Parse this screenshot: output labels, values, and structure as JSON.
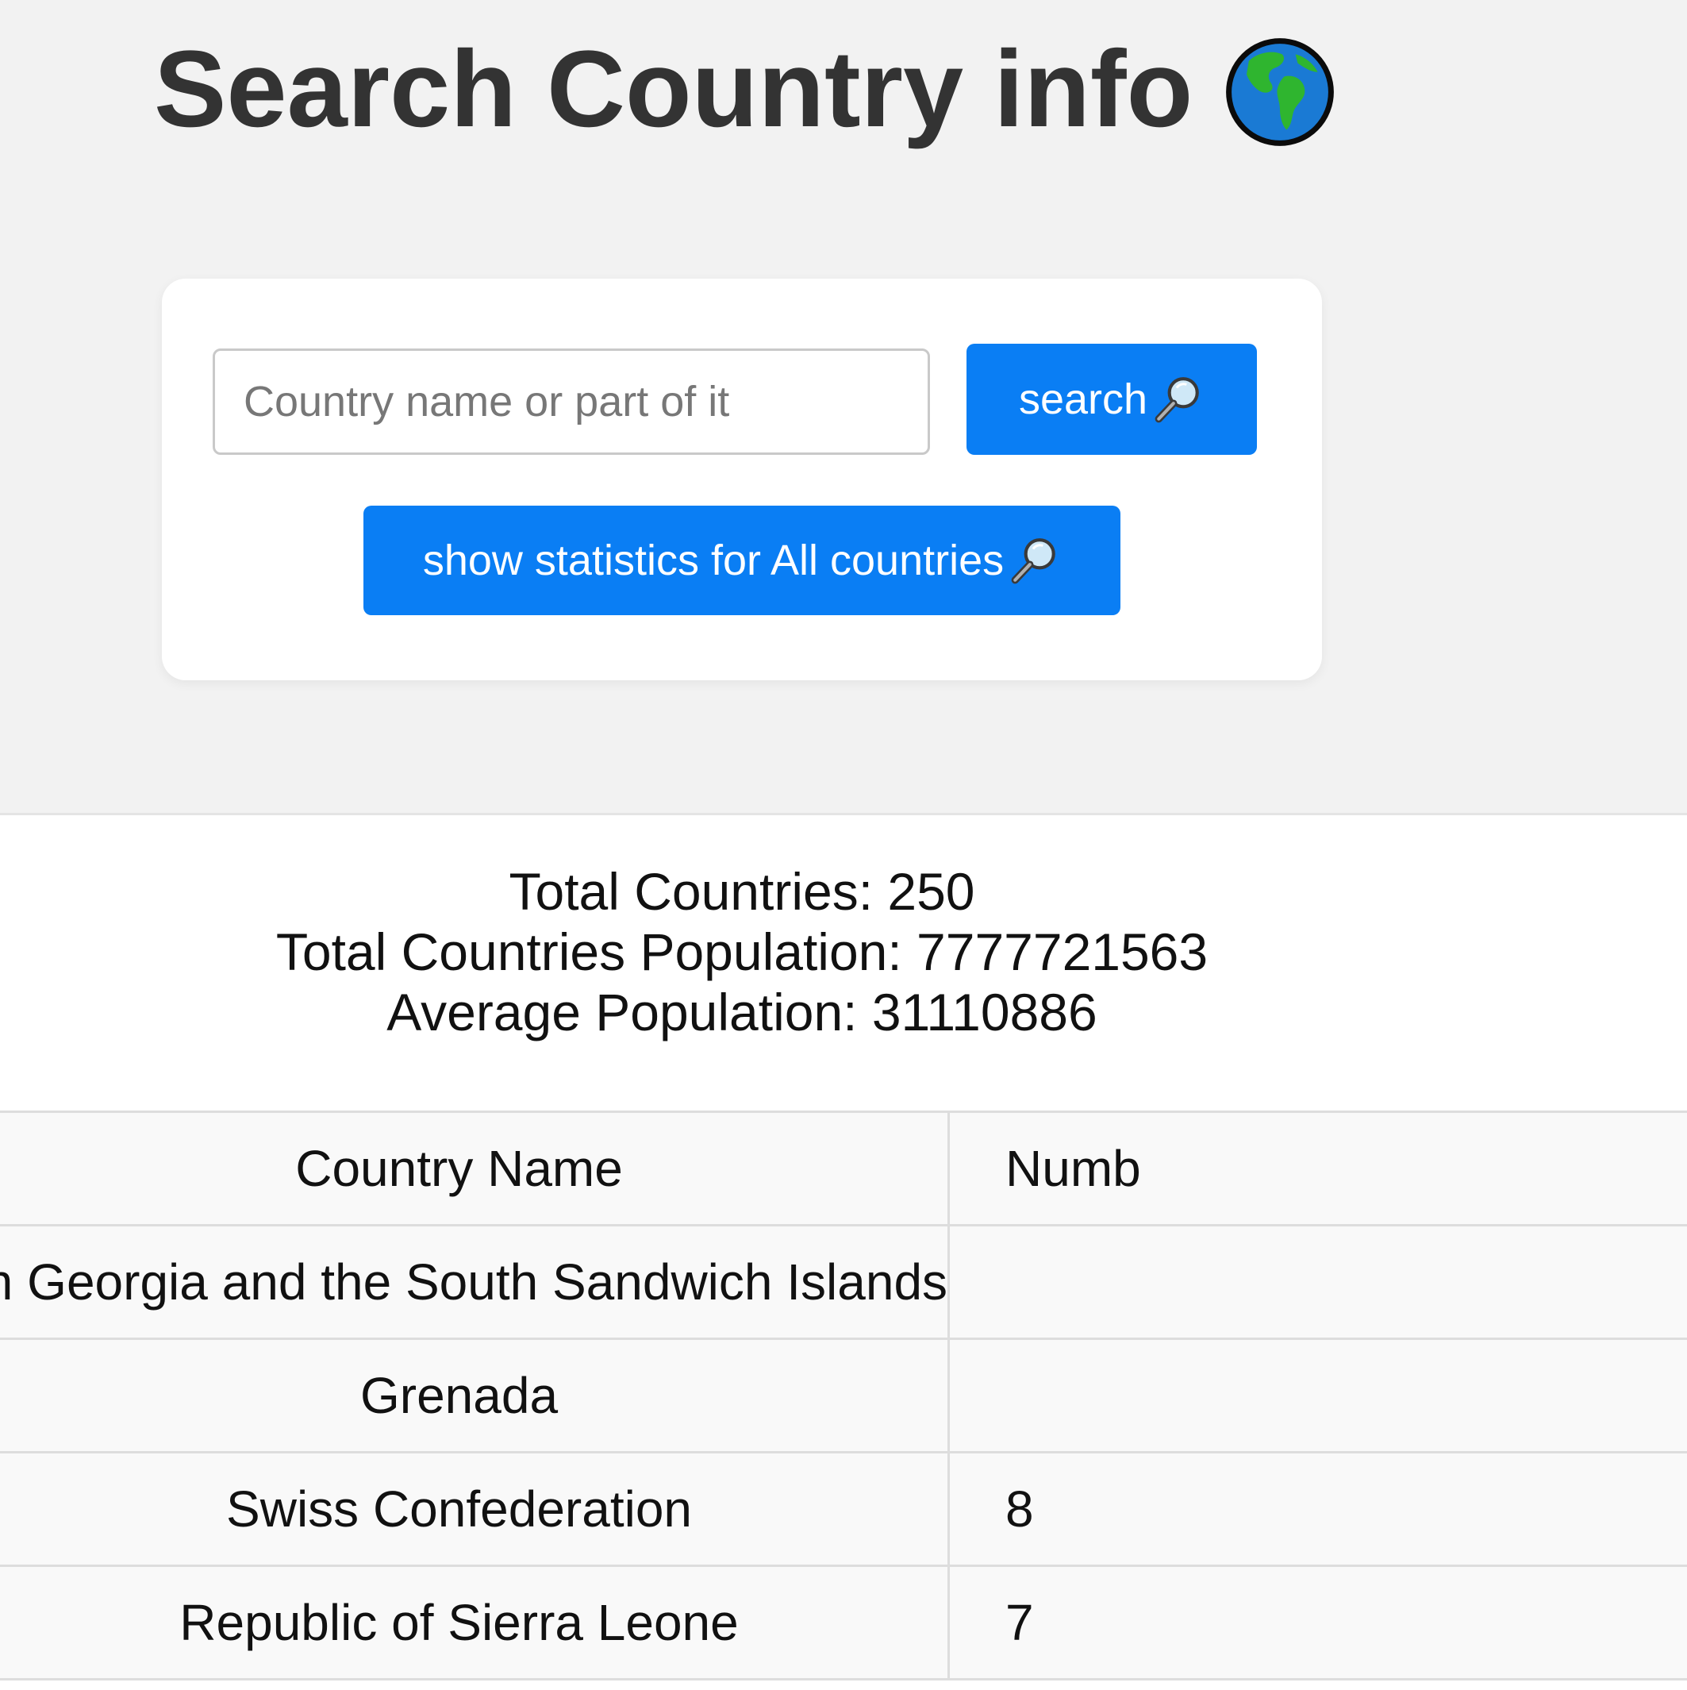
{
  "header": {
    "title": "Search Country info",
    "title_icon": "globe-americas-icon"
  },
  "search": {
    "placeholder": "Country name or part of it",
    "value": "",
    "search_label": "search",
    "search_icon": "magnifier-icon",
    "stats_label": "show statistics for All countries",
    "stats_icon": "magnifier-icon"
  },
  "stats": {
    "total_countries": "Total Countries: 250",
    "total_population": "Total Countries Population: 7777721563",
    "average_population": "Average Population: 31110886"
  },
  "table": {
    "headers": [
      "Country Name",
      "Numb"
    ],
    "rows": [
      {
        "name": "th Georgia and the South Sandwich Islands",
        "num": ""
      },
      {
        "name": "Grenada",
        "num": ""
      },
      {
        "name": "Swiss Confederation",
        "num": "8"
      },
      {
        "name": "Republic of Sierra Leone",
        "num": "7"
      }
    ]
  },
  "colors": {
    "accent": "#0a7ef4",
    "page_background": "#f2f2f2",
    "card_background": "#ffffff"
  }
}
